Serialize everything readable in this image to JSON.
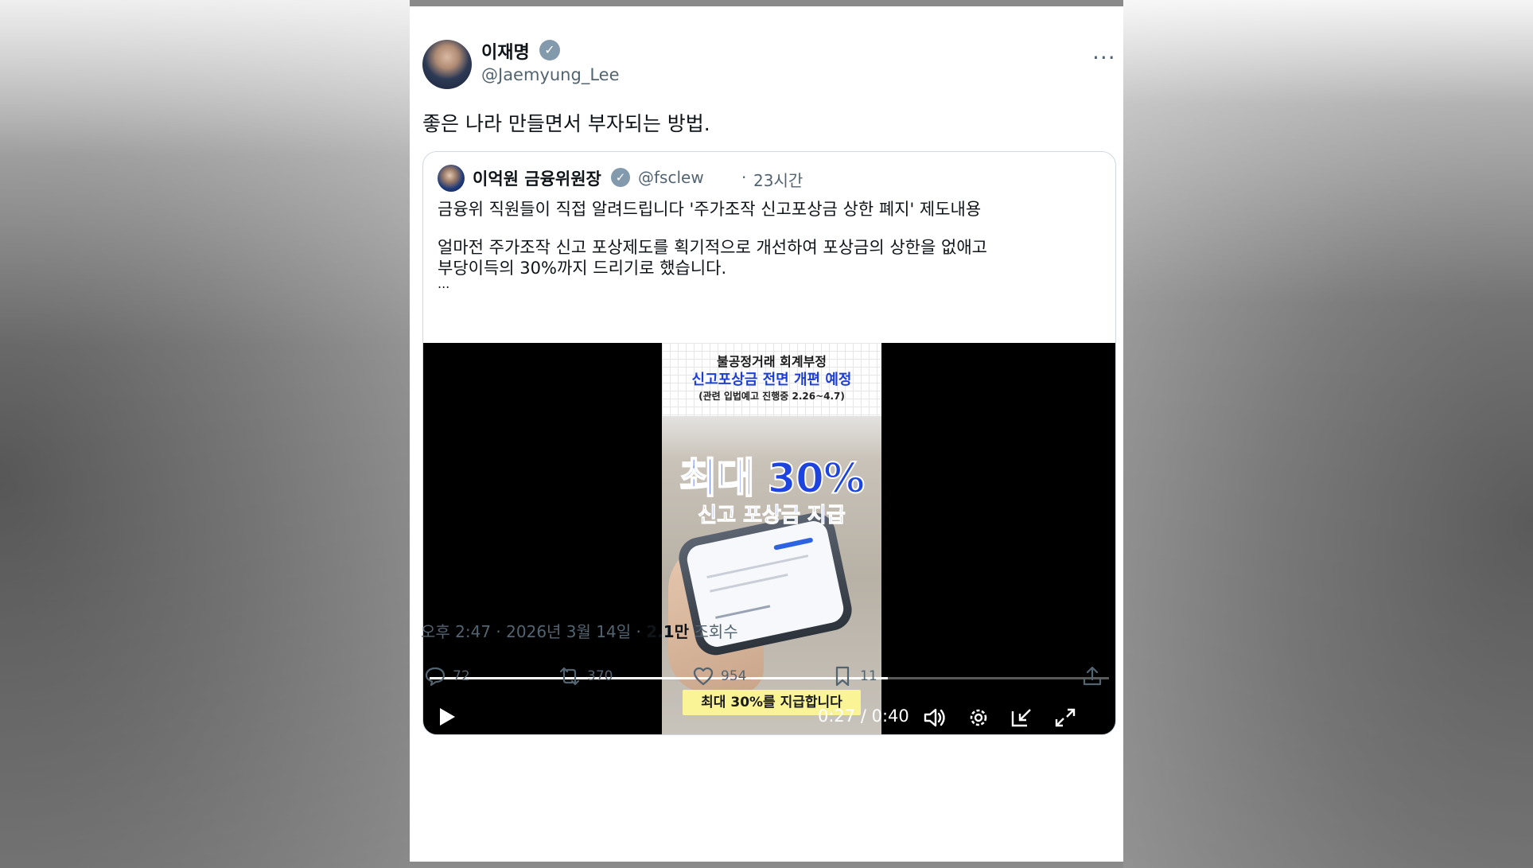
{
  "post": {
    "author_name": "이재명",
    "handle": "@Jaemyung_Lee",
    "text": "좋은 나라 만들면서 부자되는 방법.",
    "more_label": "···"
  },
  "quote": {
    "author_name": "이억원 금융위원장",
    "handle": "@fsclew",
    "separator": "·",
    "time": "23시간",
    "line1": "금융위 직원들이 직접 알려드립니다 '주가조작 신고포상금 상한 폐지' 제도내용",
    "line2": "얼마전 주가조작 신고 포상제도를 획기적으로 개선하여 포상금의 상한을 없애고",
    "line3": "부당이득의 30%까지 드리기로 했습니다.",
    "ellipsis": "..."
  },
  "video": {
    "thumb_line1": "불공정거래 회계부정",
    "thumb_line2": "신고포상금 전면 개편 예정",
    "thumb_line3": "(관련 입법예고 진행중 2.26~4.7)",
    "thumb_big": "최대 30%",
    "thumb_sub": "신고 포상금 지급",
    "thumb_bottom": "최대 30%를 지급합니다",
    "timecode": "0:27 / 0:40",
    "progress": 0.675
  },
  "meta": {
    "time": "오후 2:47 · 2026년 3월 14일 · ",
    "views": "2.1만",
    "views_label": " 조회수"
  },
  "actions": {
    "reply": "72",
    "retweet": "370",
    "like": "954",
    "bookmark": "11"
  },
  "colors": {
    "text": "#0f1419",
    "muted": "#536471",
    "verified_badge": "#829aab",
    "accent_blue": "#1e44e0"
  }
}
